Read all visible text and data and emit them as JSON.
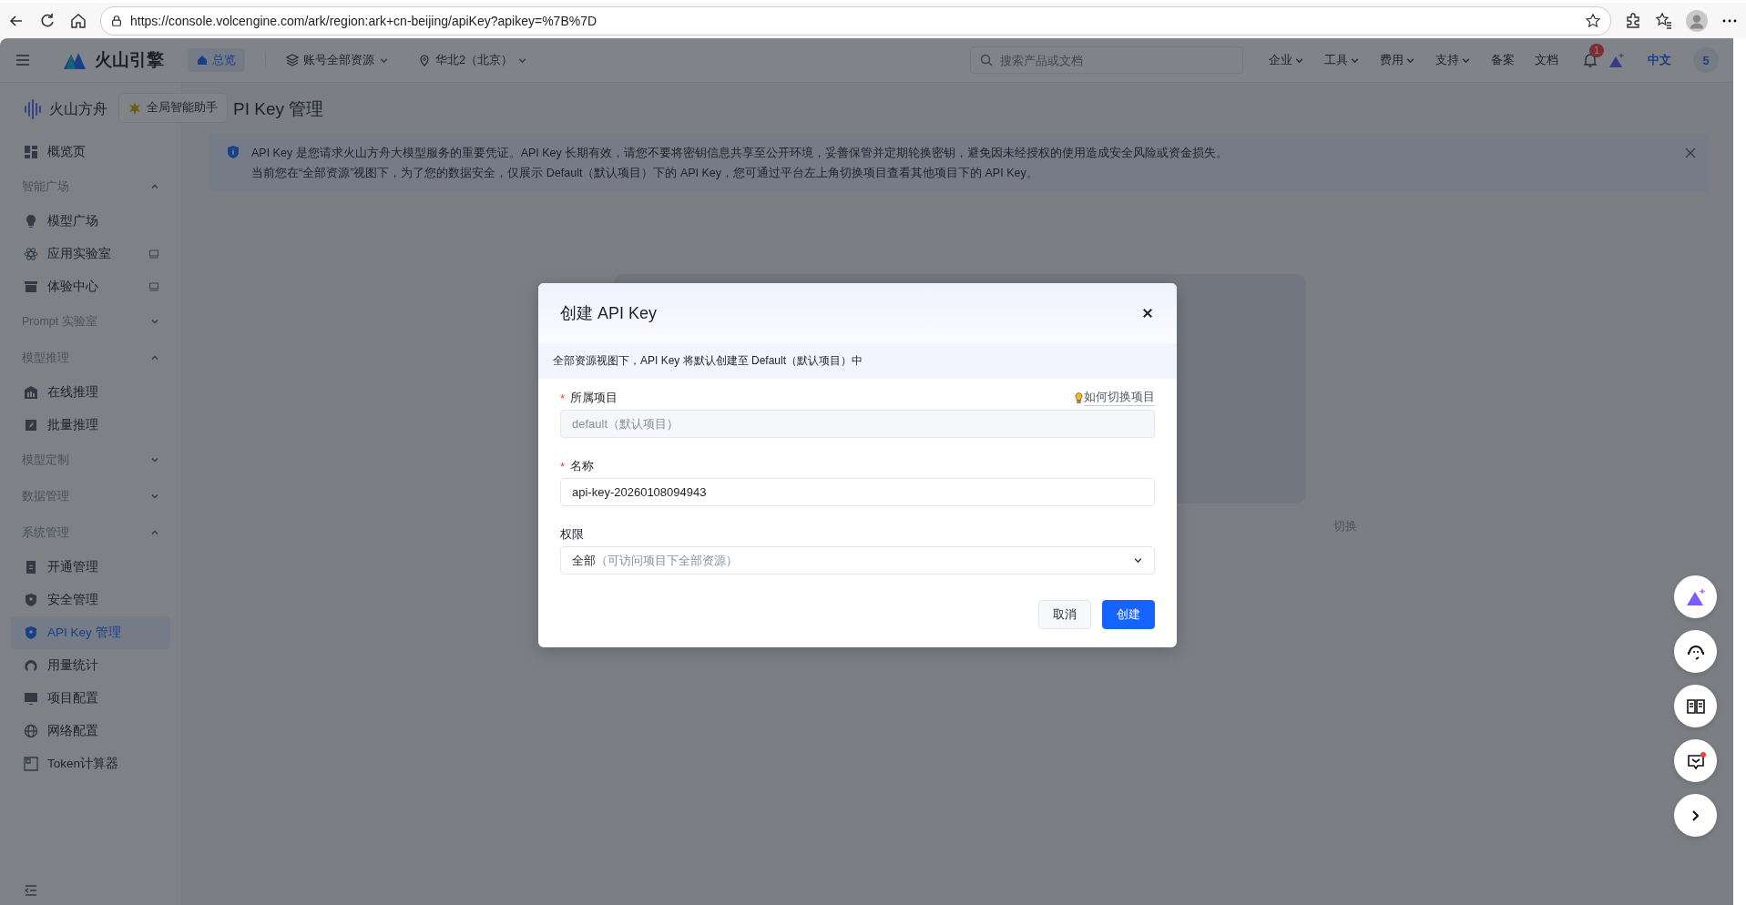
{
  "browser": {
    "url": "https://console.volcengine.com/ark/region:ark+cn-beijing/apiKey?apikey=%7B%7D"
  },
  "topnav": {
    "brand": "火山引擎",
    "overview": {
      "label": "总览",
      "selected": true
    },
    "resource_scope": "账号全部资源",
    "region": "华北2（北京）",
    "search": {
      "placeholder": "搜索产品或文档"
    },
    "menus": [
      {
        "label": "企业",
        "dropdown": true
      },
      {
        "label": "工具",
        "dropdown": true
      },
      {
        "label": "费用",
        "dropdown": true
      },
      {
        "label": "支持",
        "dropdown": true
      },
      {
        "label": "备案",
        "dropdown": false
      },
      {
        "label": "文档",
        "dropdown": false
      }
    ],
    "notification_count": "1",
    "language": {
      "label": "中文",
      "selected": true
    },
    "avatar": "5"
  },
  "sidebar": {
    "product": "火山方舟",
    "assistant_tooltip": "全局智能助手",
    "items": [
      {
        "kind": "item",
        "label": "概览页",
        "selected": false,
        "monitor": false
      },
      {
        "kind": "group",
        "label": "智能广场",
        "expanded": true,
        "children": [
          {
            "kind": "item",
            "label": "模型广场",
            "selected": false,
            "monitor": false
          },
          {
            "kind": "item",
            "label": "应用实验室",
            "selected": false,
            "monitor": true
          },
          {
            "kind": "item",
            "label": "体验中心",
            "selected": false,
            "monitor": true
          }
        ]
      },
      {
        "kind": "group",
        "label": "Prompt 实验室",
        "expanded": false
      },
      {
        "kind": "group",
        "label": "模型推理",
        "expanded": true,
        "children": [
          {
            "kind": "item",
            "label": "在线推理",
            "selected": false,
            "monitor": false
          },
          {
            "kind": "item",
            "label": "批量推理",
            "selected": false,
            "monitor": false
          }
        ]
      },
      {
        "kind": "group",
        "label": "模型定制",
        "expanded": false
      },
      {
        "kind": "group",
        "label": "数据管理",
        "expanded": false
      },
      {
        "kind": "group",
        "label": "系统管理",
        "expanded": true,
        "children": [
          {
            "kind": "item",
            "label": "开通管理",
            "selected": false,
            "monitor": false
          },
          {
            "kind": "item",
            "label": "安全管理",
            "selected": false,
            "monitor": false
          },
          {
            "kind": "item",
            "label": "API Key 管理",
            "selected": true,
            "monitor": false
          },
          {
            "kind": "item",
            "label": "用量统计",
            "selected": false,
            "monitor": false
          },
          {
            "kind": "item",
            "label": "项目配置",
            "selected": false,
            "monitor": false
          },
          {
            "kind": "item",
            "label": "网络配置",
            "selected": false,
            "monitor": false
          },
          {
            "kind": "item",
            "label": "Token计算器",
            "selected": false,
            "monitor": false
          }
        ]
      }
    ]
  },
  "page": {
    "title": "PI Key 管理",
    "notice_lines": [
      "API Key 是您请求火山方舟大模型服务的重要凭证。API Key 长期有效，请您不要将密钥信息共享至公开环境，妥善保管并定期轮换密钥，避免因未经授权的使用造成安全风险或资金损失。",
      "当前您在“全部资源”视图下，为了您的数据安全，仅展示 Default（默认项目）下的 API Key，您可通过平台左上角切换项目查看其他项目下的 API Key。"
    ],
    "hidden_hint": "切换"
  },
  "dialog": {
    "title": "创建 API Key",
    "notice": "全部资源视图下，API Key 将默认创建至 Default（默认项目）中",
    "fields": [
      {
        "kind": "input",
        "label": "所属项目",
        "required_mark": "*",
        "disabled": true,
        "help_link": "如何切换项目",
        "value": "default（默认项目）"
      },
      {
        "kind": "input",
        "label": "名称",
        "required_mark": "*",
        "disabled": false,
        "value": "api-key-20260108094943"
      },
      {
        "kind": "select",
        "label": "权限",
        "value": "全部",
        "hint": "（可访问项目下全部资源）"
      }
    ],
    "buttons": [
      {
        "label": "取消",
        "kind": "secondary"
      },
      {
        "label": "创建",
        "kind": "primary"
      }
    ]
  }
}
